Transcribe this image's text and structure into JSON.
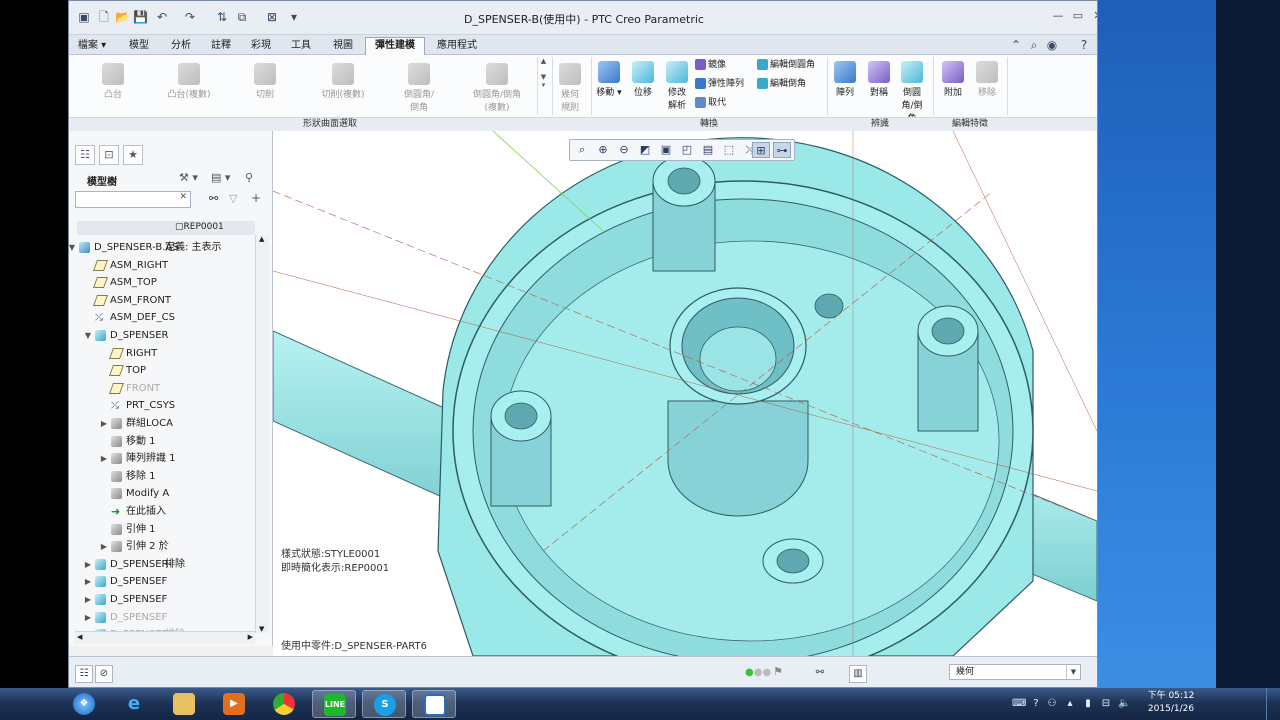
{
  "window": {
    "title": "D_SPENSER-B(使用中) - PTC Creo Parametric"
  },
  "menu": {
    "tabs": [
      "檔案",
      "模型",
      "分析",
      "註釋",
      "彩現",
      "工具",
      "視圖",
      "彈性建模",
      "應用程式"
    ],
    "active": "彈性建模"
  },
  "ribbon": {
    "shape_surface": {
      "label": "形狀曲面選取",
      "buttons": [
        {
          "label": "凸台",
          "enabled": false
        },
        {
          "label": "凸台(複數)",
          "enabled": false
        },
        {
          "label": "切削",
          "enabled": false
        },
        {
          "label": "切削(複數)",
          "enabled": false
        },
        {
          "label": "倒圓角/倒角",
          "enabled": false
        },
        {
          "label": "倒圓角/倒角(複數)",
          "enabled": false
        },
        {
          "label": "幾何規則",
          "enabled": false
        }
      ]
    },
    "transform": {
      "label": "轉換",
      "buttons": [
        "移動",
        "位移",
        "修改解析"
      ],
      "small": [
        "鏡像",
        "彈性陣列",
        "取代",
        "編輯倒圓角",
        "編輯倒角"
      ]
    },
    "recognize": {
      "label": "辨識",
      "buttons": [
        "陣列",
        "對稱",
        "倒圓角/倒角"
      ]
    },
    "edit_feature": {
      "label": "編輯特徵",
      "buttons": [
        {
          "label": "附加",
          "enabled": true
        },
        {
          "label": "移除",
          "enabled": false
        }
      ]
    }
  },
  "model_tree": {
    "header": "模型樹",
    "rep_label": "REP0001",
    "items": [
      {
        "label": "D_SPENSER-B.AS",
        "icon": "asm",
        "indent": 0,
        "expand": "▼",
        "extra": "定義: 主表示"
      },
      {
        "label": "ASM_RIGHT",
        "icon": "plane",
        "indent": 1
      },
      {
        "label": "ASM_TOP",
        "icon": "plane",
        "indent": 1
      },
      {
        "label": "ASM_FRONT",
        "icon": "plane",
        "indent": 1
      },
      {
        "label": "ASM_DEF_CS",
        "icon": "csys",
        "indent": 1
      },
      {
        "label": "D_SPENSER",
        "icon": "part",
        "indent": 1,
        "expand": "▼"
      },
      {
        "label": "RIGHT",
        "icon": "plane",
        "indent": 2
      },
      {
        "label": "TOP",
        "icon": "plane",
        "indent": 2
      },
      {
        "label": "FRONT",
        "icon": "plane",
        "indent": 2,
        "dim": true
      },
      {
        "label": "PRT_CSYS",
        "icon": "csys",
        "indent": 2
      },
      {
        "label": "群組LOCA",
        "icon": "feat",
        "indent": 2,
        "expand": "▶"
      },
      {
        "label": "移動 1",
        "icon": "feat",
        "indent": 2
      },
      {
        "label": "陣列辨識 1",
        "icon": "feat",
        "indent": 2,
        "expand": "▶"
      },
      {
        "label": "移除 1",
        "icon": "feat",
        "indent": 2
      },
      {
        "label": "Modify A",
        "icon": "feat",
        "indent": 2
      },
      {
        "label": "在此插入",
        "icon": "arrow",
        "indent": 2
      },
      {
        "label": "引伸 1",
        "icon": "feat",
        "indent": 2
      },
      {
        "label": "引伸 2 於",
        "icon": "feat",
        "indent": 2,
        "expand": "▶"
      },
      {
        "label": "D_SPENSER-",
        "icon": "part",
        "indent": 1,
        "expand": "▶",
        "extra": "排除"
      },
      {
        "label": "D_SPENSEF",
        "icon": "part",
        "indent": 1,
        "expand": "▶"
      },
      {
        "label": "D_SPENSEF",
        "icon": "part",
        "indent": 1,
        "expand": "▶"
      },
      {
        "label": "D_SPENSEF",
        "icon": "part",
        "indent": 1,
        "expand": "▶",
        "dim": true
      },
      {
        "label": "D_SPENSER-",
        "icon": "part",
        "indent": 1,
        "expand": "▶",
        "dim": true,
        "extra": "排除"
      }
    ]
  },
  "viewport": {
    "style_state": "樣式狀態:STYLE0001",
    "simplified_rep": "即時簡化表示:REP0001",
    "active_part": "使用中零件:D_SPENSER-PART6",
    "model_color": "#99e8e8",
    "model_dark": "#5eaab2"
  },
  "statusbar": {
    "filter_value": "幾何"
  },
  "taskbar": {
    "apps": [
      "start-orb",
      "ie",
      "explorer",
      "media-player",
      "chrome",
      "line",
      "skype",
      "creo"
    ],
    "clock_time": "下午 05:12",
    "clock_date": "2015/1/26"
  }
}
